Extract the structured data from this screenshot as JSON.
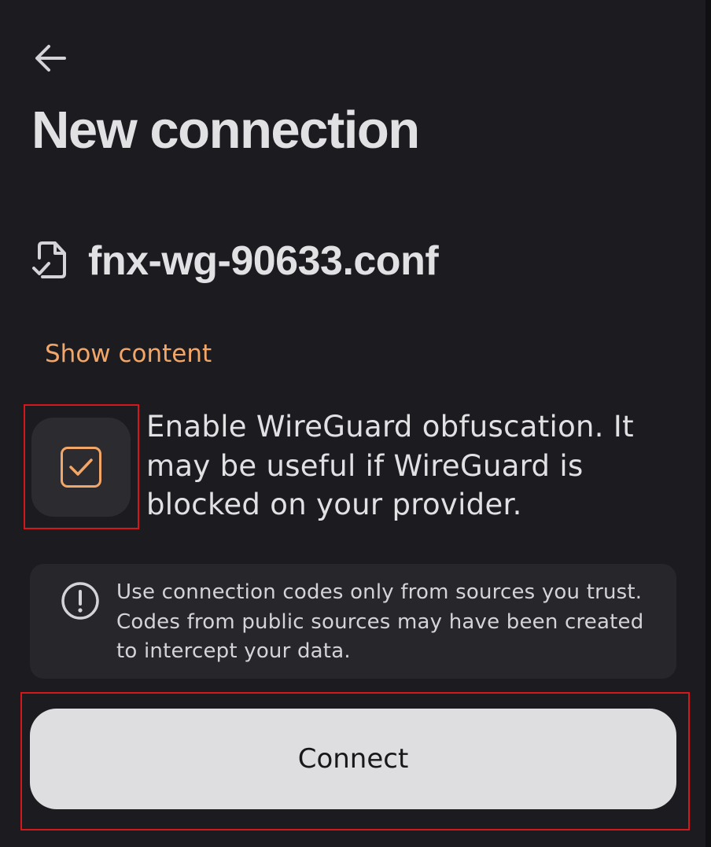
{
  "header": {
    "back_icon": "arrow-left-icon",
    "title": "New connection"
  },
  "file": {
    "icon": "file-check-icon",
    "name": "fnx-wg-90633.conf"
  },
  "show_content_label": "Show content",
  "obfuscation": {
    "checked": true,
    "label": "Enable WireGuard obfuscation. It may be useful if WireGuard is blocked on your provider."
  },
  "warning": {
    "icon": "alert-circle-icon",
    "text": "Use connection codes only from sources you trust. Codes from public sources may have been created to intercept your data."
  },
  "connect_label": "Connect",
  "colors": {
    "background": "#1c1c20",
    "accent": "#f2a668",
    "card": "#26262b",
    "button": "#dedee1",
    "highlight": "#d3171b"
  }
}
